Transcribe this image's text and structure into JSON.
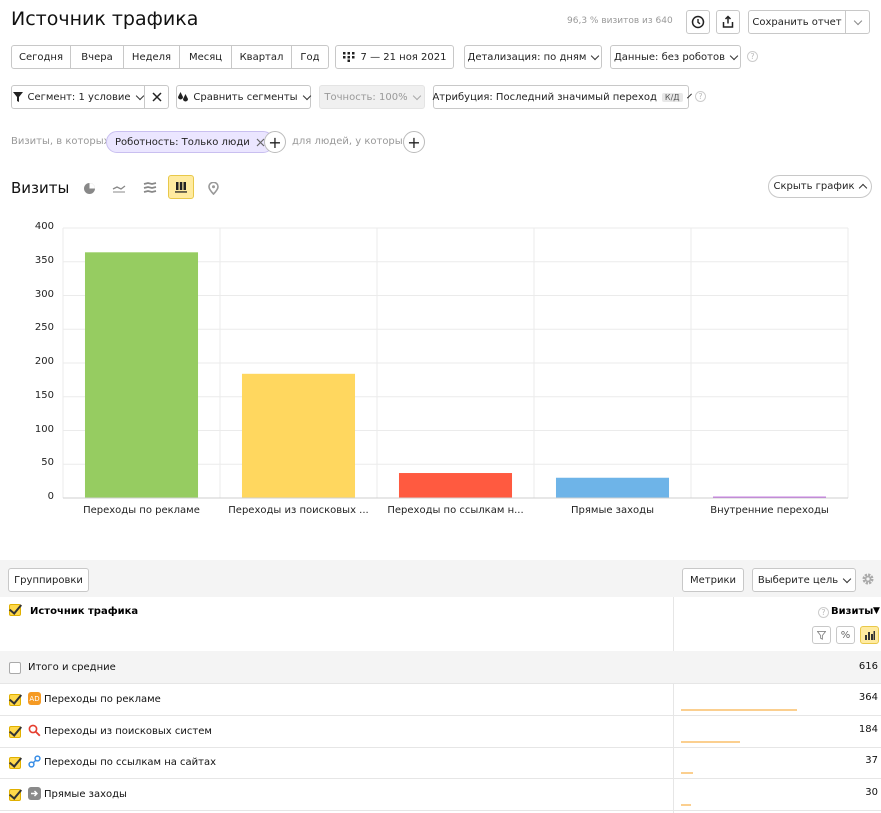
{
  "header": {
    "title": "Источник трафика",
    "sampling": "96,3 % визитов из 640",
    "save_label": "Сохранить отчет"
  },
  "periods": [
    "Сегодня",
    "Вчера",
    "Неделя",
    "Месяц",
    "Квартал",
    "Год"
  ],
  "date_range": "7 — 21 ноя 2021",
  "detail_dropdown": "Детализация: по дням",
  "data_dropdown": "Данные: без роботов",
  "segment": {
    "label": "Сегмент: 1 условие",
    "compare": "Сравнить сегменты",
    "accuracy": "Точность: 100%",
    "attribution": "Атрибуция: Последний значимый переход",
    "attribution_badge": "К/Д"
  },
  "filter": {
    "visits_prefix": "Визиты, в которых",
    "chip": "Роботность: Только люди",
    "people_prefix": "для людей, у которых"
  },
  "chart_section": {
    "title": "Визиты",
    "hide_label": "Скрыть график"
  },
  "chart_data": {
    "type": "bar",
    "categories": [
      "Переходы по рекламе",
      "Переходы из поисковых ...",
      "Переходы по ссылкам н...",
      "Прямые заходы",
      "Внутренние переходы"
    ],
    "values": [
      364,
      184,
      37,
      30,
      2
    ],
    "colors": [
      "#96cc61",
      "#ffd75f",
      "#ff5a40",
      "#6eb4e8",
      "#b14ed8"
    ],
    "ylim": [
      0,
      400
    ],
    "yticks": [
      "0",
      "50",
      "100",
      "150",
      "200",
      "250",
      "300",
      "350",
      "400"
    ],
    "grid": true
  },
  "table": {
    "groupings_label": "Группировки",
    "metrics_label": "Метрики",
    "goal_label": "Выберите цель",
    "dim_header": "Источник трафика",
    "metric_header": "Визиты",
    "totals_label": "Итого и средние",
    "totals_value": "616",
    "rows": [
      {
        "label": "Переходы по рекламе",
        "value": "364",
        "icon": "ad-icon",
        "share": 0.591
      },
      {
        "label": "Переходы из поисковых систем",
        "value": "184",
        "icon": "search-icon",
        "share": 0.299
      },
      {
        "label": "Переходы по ссылкам на сайтах",
        "value": "37",
        "icon": "link-icon",
        "share": 0.06
      },
      {
        "label": "Прямые заходы",
        "value": "30",
        "icon": "direct-icon",
        "share": 0.049
      }
    ]
  }
}
